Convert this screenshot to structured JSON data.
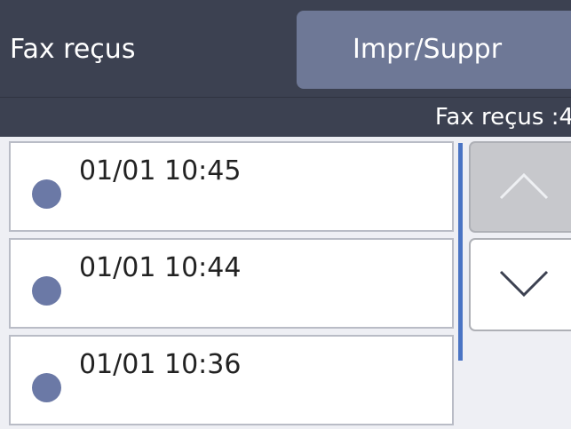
{
  "header": {
    "title": "Fax reçus",
    "print_delete_label": "Impr/Suppr"
  },
  "status": {
    "received_count": "Fax reçus :4"
  },
  "fax_list": {
    "items": [
      {
        "time": "01/01 10:45"
      },
      {
        "time": "01/01 10:44"
      },
      {
        "time": "01/01 10:36"
      }
    ]
  },
  "scroll": {
    "up_icon": "chevron-up-icon",
    "down_icon": "chevron-down-icon"
  },
  "colors": {
    "header_bg": "#3c4151",
    "button_bg": "#6e7896",
    "dot": "#6b79a6",
    "scrollbar": "#4a74c4"
  }
}
